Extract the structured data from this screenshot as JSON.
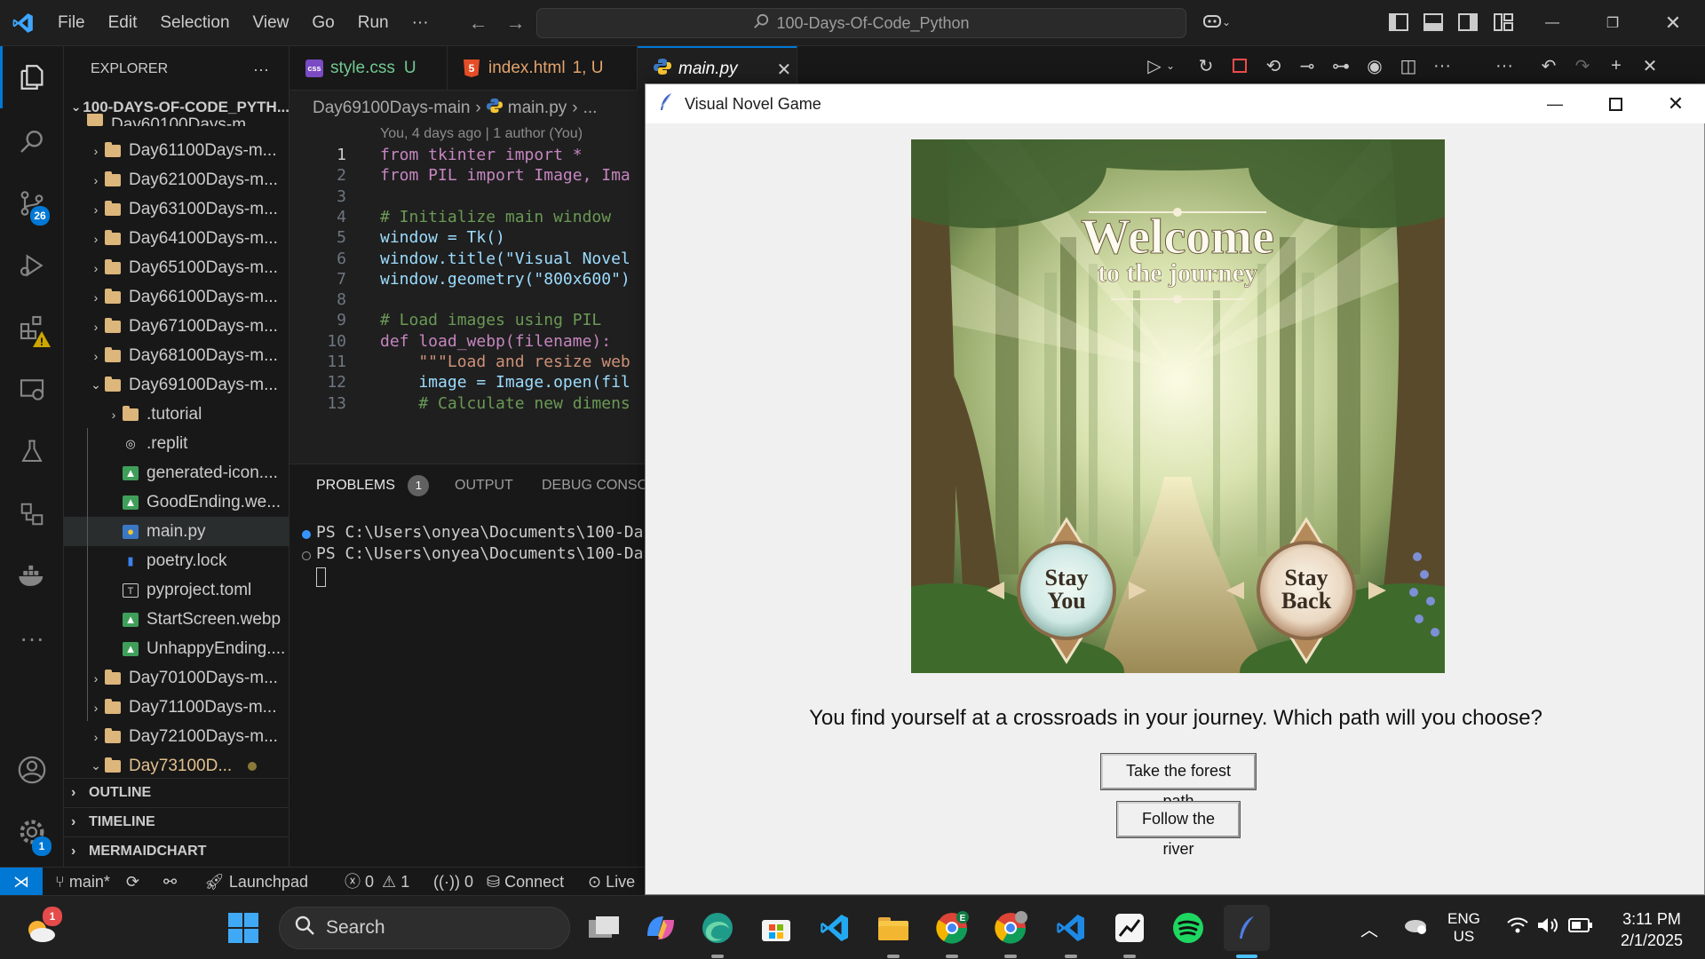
{
  "titlebar": {
    "menu": [
      "File",
      "Edit",
      "Selection",
      "View",
      "Go",
      "Run",
      "···"
    ],
    "search_text": "100-Days-Of-Code_Python"
  },
  "activity_bar": {
    "source_control_badge": "26",
    "settings_badge": "1"
  },
  "sidebar": {
    "title": "EXPLORER",
    "more": "···",
    "root": "100-DAYS-OF-CODE_PYTH...",
    "partial_top": "Day60100Days-m...",
    "items": [
      {
        "label": "Day61100Days-m...",
        "type": "folder",
        "chev": "›"
      },
      {
        "label": "Day62100Days-m...",
        "type": "folder",
        "chev": "›"
      },
      {
        "label": "Day63100Days-m...",
        "type": "folder",
        "chev": "›"
      },
      {
        "label": "Day64100Days-m...",
        "type": "folder",
        "chev": "›"
      },
      {
        "label": "Day65100Days-m...",
        "type": "folder",
        "chev": "›"
      },
      {
        "label": "Day66100Days-m...",
        "type": "folder",
        "chev": "›"
      },
      {
        "label": "Day67100Days-m...",
        "type": "folder",
        "chev": "›"
      },
      {
        "label": "Day68100Days-m...",
        "type": "folder",
        "chev": "›"
      },
      {
        "label": "Day69100Days-m...",
        "type": "folder",
        "chev": "⌄"
      },
      {
        "label": ".tutorial",
        "type": "folder",
        "chev": "›"
      },
      {
        "label": ".replit",
        "type": "replit"
      },
      {
        "label": "generated-icon....",
        "type": "image"
      },
      {
        "label": "GoodEnding.we...",
        "type": "image"
      },
      {
        "label": "main.py",
        "type": "python"
      },
      {
        "label": "poetry.lock",
        "type": "lock"
      },
      {
        "label": "pyproject.toml",
        "type": "toml"
      },
      {
        "label": "StartScreen.webp",
        "type": "image"
      },
      {
        "label": "UnhappyEnding....",
        "type": "image"
      },
      {
        "label": "Day70100Days-m...",
        "type": "folder",
        "chev": "›"
      },
      {
        "label": "Day71100Days-m...",
        "type": "folder",
        "chev": "›"
      },
      {
        "label": "Day72100Days-m...",
        "type": "folder",
        "chev": "›"
      },
      {
        "label": "Day73100D...",
        "type": "folder",
        "chev": "⌄"
      }
    ],
    "sections": [
      "OUTLINE",
      "TIMELINE",
      "MERMAIDCHART"
    ]
  },
  "tabs": [
    {
      "label": "style.css",
      "status": "U",
      "icon": "css"
    },
    {
      "label": "index.html",
      "status": "1, U",
      "icon": "html"
    },
    {
      "label": "main.py",
      "status": "",
      "icon": "python"
    }
  ],
  "breadcrumb": {
    "folder": "Day69100Days-main",
    "file": "main.py",
    "more": "..."
  },
  "editor": {
    "blame": "You, 4 days ago | 1 author (You)",
    "lines": [
      {
        "n": "1",
        "text": "from tkinter import *"
      },
      {
        "n": "2",
        "text": "from PIL import Image, Ima"
      },
      {
        "n": "3",
        "text": ""
      },
      {
        "n": "4",
        "text": "# Initialize main window"
      },
      {
        "n": "5",
        "text": "window = Tk()"
      },
      {
        "n": "6",
        "text": "window.title(\"Visual Novel"
      },
      {
        "n": "7",
        "text": "window.geometry(\"800x600\")"
      },
      {
        "n": "8",
        "text": ""
      },
      {
        "n": "9",
        "text": "# Load images using PIL"
      },
      {
        "n": "10",
        "text": "def load_webp(filename):"
      },
      {
        "n": "11",
        "text": "    \"\"\"Load and resize web"
      },
      {
        "n": "12",
        "text": "    image = Image.open(fil"
      },
      {
        "n": "13",
        "text": "    # Calculate new dimens"
      }
    ]
  },
  "panel": {
    "tabs": [
      "PROBLEMS",
      "OUTPUT",
      "DEBUG CONSOLE"
    ],
    "problems_count": "1",
    "terminal_lines": [
      "PS C:\\Users\\onyea\\Documents\\100-Da",
      "PS C:\\Users\\onyea\\Documents\\100-Da"
    ]
  },
  "statusbar": {
    "branch": "main*",
    "launchpad": "Launchpad",
    "errors": "0",
    "warnings": "1",
    "ports": "0",
    "connect": "Connect",
    "live": "Live"
  },
  "app_window": {
    "title": "Visual Novel Game",
    "scene_title_line1": "Welcome",
    "scene_title_line2": "to the journey",
    "badge_left": [
      "Stay",
      "You"
    ],
    "badge_right": [
      "Stay",
      "Back"
    ],
    "story_text": "You find yourself at a crossroads in your journey. Which path will you choose?",
    "button_forest": "Take the forest path",
    "button_river": "Follow the river"
  },
  "taskbar": {
    "search_placeholder": "Search",
    "weather_badge": "1",
    "lang_line1": "ENG",
    "lang_line2": "US",
    "time": "3:11 PM",
    "date": "2/1/2025"
  },
  "colors": {
    "vscode_accent": "#0078d4",
    "tk_background": "#f0f0f0",
    "folder": "#dcb67a"
  }
}
